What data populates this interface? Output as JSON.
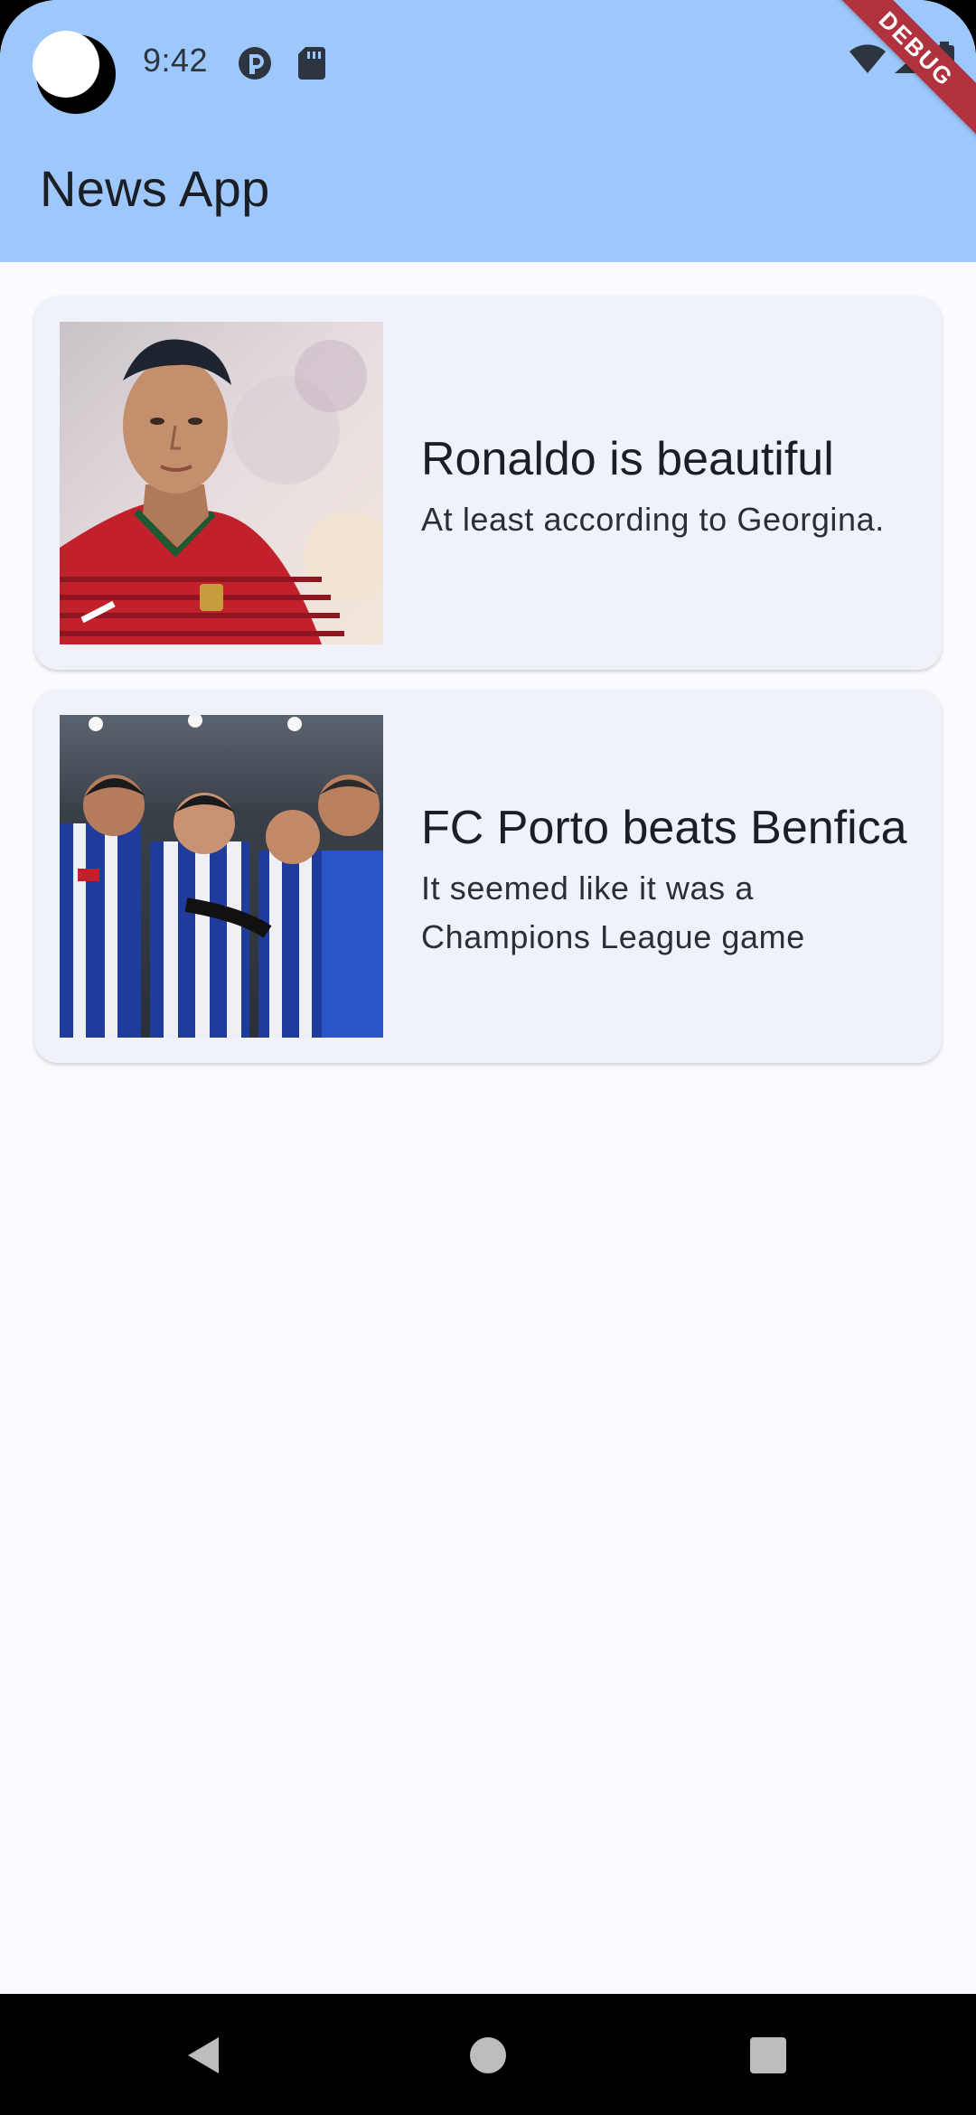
{
  "status_bar": {
    "time": "9:42"
  },
  "debug_banner": "DEBUG",
  "app_bar": {
    "title": "News App"
  },
  "articles": [
    {
      "title": "Ronaldo is beautiful",
      "subtitle": "At least according to Georgina.",
      "image": "portrait-photo"
    },
    {
      "title": "FC Porto beats Benfica",
      "subtitle": "It seemed like it was a Champions League game",
      "image": "team-celebration-photo"
    }
  ],
  "colors": {
    "app_bar": "#9ec8fb",
    "background": "#fbfaff",
    "card": "#eff2f8",
    "debug_ribbon": "#b0323e"
  },
  "nav_bar": {
    "icons": [
      "back-icon",
      "home-icon",
      "recents-icon"
    ]
  }
}
